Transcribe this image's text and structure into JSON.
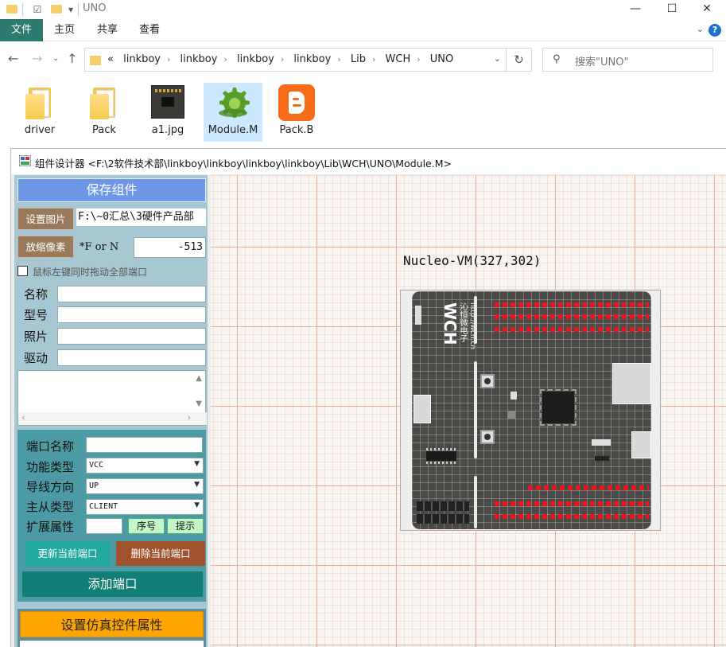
{
  "explorer": {
    "window_title": "UNO",
    "ribbon_tabs": [
      "文件",
      "主页",
      "共享",
      "查看"
    ],
    "address": {
      "prefix": "«",
      "crumbs": [
        "linkboy",
        "linkboy",
        "linkboy",
        "linkboy",
        "Lib",
        "WCH",
        "UNO"
      ]
    },
    "search_placeholder": "搜索\"UNO\"",
    "files": [
      {
        "name": "driver",
        "icon": "folder-icon"
      },
      {
        "name": "Pack",
        "icon": "folder-icon"
      },
      {
        "name": "a1.jpg",
        "icon": "image-thumbnail-icon"
      },
      {
        "name": "Module.M",
        "icon": "gear-icon",
        "selected": true
      },
      {
        "name": "Pack.B",
        "icon": "blogger-icon"
      }
    ]
  },
  "designer": {
    "title": "组件设计器 <F:\\2软件技术部\\linkboy\\linkboy\\linkboy\\linkboy\\Lib\\WCH\\UNO\\Module.M>",
    "save_button": "保存组件",
    "set_image_button": "设置图片",
    "image_path": "F:\\~0汇总\\3硬件产品部",
    "scale_button": "放缩像素",
    "f_or_n_label": "*F or N",
    "scale_value": "-513",
    "drag_all_ports_label": "鼠标左键同时拖动全部端口",
    "fields": {
      "name_label": "名称",
      "model_label": "型号",
      "photo_label": "照片",
      "driver_label": "驱动"
    },
    "port": {
      "name_label": "端口名称",
      "func_type_label": "功能类型",
      "func_type_value": "VCC",
      "wire_dir_label": "导线方向",
      "wire_dir_value": "UP",
      "master_slave_label": "主从类型",
      "master_slave_value": "CLIENT",
      "ext_attr_label": "扩展属性",
      "seq_button": "序号",
      "hint_button": "提示",
      "update_button": "更新当前端口",
      "delete_button": "删除当前端口",
      "add_button": "添加端口"
    },
    "sim_button": "设置仿真控件属性",
    "canvas": {
      "component_label": "Nucleo-VM(327,302)",
      "board_logo": "沁恒微电子",
      "board_url": "http://wch.cn",
      "board_brand": "WCH"
    },
    "colors": {
      "save_button": "#6f97e8",
      "panel_bg": "#a7c8d3",
      "port_box": "#4b9aa4",
      "sim_button": "#ffa500",
      "pin_red": "#e8141e"
    }
  }
}
